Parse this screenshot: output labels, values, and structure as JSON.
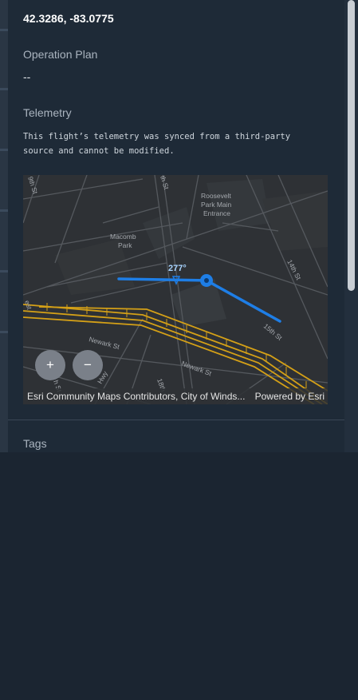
{
  "location": {
    "coordinates": "42.3286, -83.0775"
  },
  "operation_plan": {
    "label": "Operation Plan",
    "value": "--"
  },
  "telemetry": {
    "label": "Telemetry",
    "note": "This flight’s telemetry was synced from a third-party\nsource and cannot be modified."
  },
  "map": {
    "heading_label": "277°",
    "labels": {
      "roosevelt_1": "Roosevelt",
      "roosevelt_2": "Park Main",
      "roosevelt_3": "Entrance",
      "macomb_1": "Macomb",
      "macomb_2": "Park",
      "street_9th": "9th St",
      "street_nth": "th St",
      "street_14th": "14th St",
      "street_15th": "15th St",
      "street_newark_1": "Newark St",
      "street_newark_2": "Newark St",
      "street_18th": "18th",
      "street_hwy": "Hwy",
      "street_ne": "h St",
      "street_west": "est"
    },
    "zoom_in_label": "+",
    "zoom_out_label": "−",
    "attribution": "Esri Community Maps Contributors, City of Winds...",
    "powered_by": "Powered by Esri",
    "colors": {
      "flight_path": "#1e7ee6",
      "railway": "#d4a017",
      "background": "#2e3135"
    }
  },
  "tags": {
    "label": "Tags"
  }
}
